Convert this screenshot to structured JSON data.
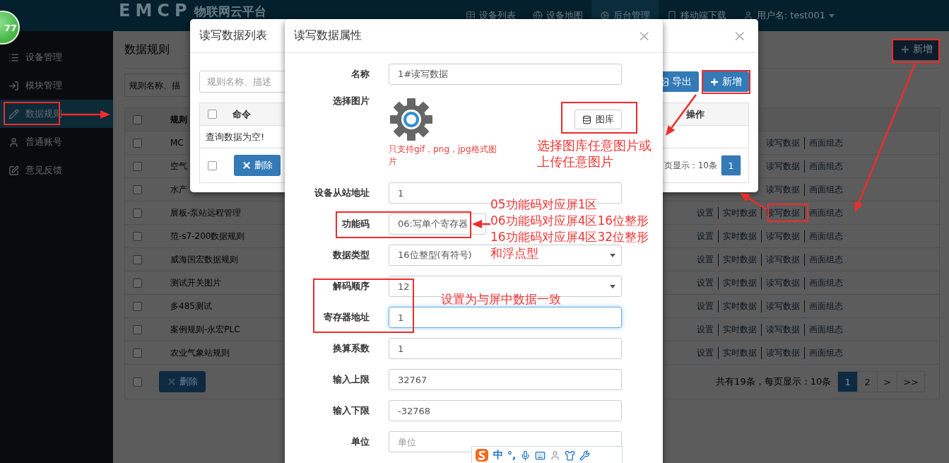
{
  "badge": {
    "text": "77"
  },
  "header": {
    "logo": "EMCP",
    "title": "物联网云平台",
    "nav": [
      {
        "label": "设备列表",
        "selected": false
      },
      {
        "label": "设备地图",
        "selected": false
      },
      {
        "label": "后台管理",
        "selected": true
      },
      {
        "label": "移动端下载",
        "selected": false
      },
      {
        "label": "用户名: test001",
        "selected": false
      }
    ]
  },
  "sidebar": {
    "items": [
      {
        "label": "设备管理",
        "selected": false
      },
      {
        "label": "模块管理",
        "selected": false
      },
      {
        "label": "数据规则",
        "selected": true
      },
      {
        "label": "普通账号",
        "selected": false
      },
      {
        "label": "意见反馈",
        "selected": false
      }
    ]
  },
  "page": {
    "title": "数据规则",
    "add_button": "新增",
    "search": {
      "placeholder": "规则名称、描"
    },
    "table": {
      "header": {
        "name": "规则",
        "checked": false
      },
      "rows": [
        {
          "name": "MC",
          "checked": false,
          "actions": [
            "读写数据",
            "画面组态"
          ]
        },
        {
          "name": "空气",
          "checked": false,
          "actions": [
            "读写数据",
            "画面组态"
          ]
        },
        {
          "name": "水产",
          "checked": false,
          "actions": [
            "读写数据",
            "画面组态"
          ]
        },
        {
          "name": "展板-泵站远程管理",
          "checked": false,
          "actions": [
            "设置",
            "实时数据",
            "读写数据",
            "画面组态"
          ]
        },
        {
          "name": "范-s7-200数据规则",
          "checked": false,
          "actions": [
            "设置",
            "实时数据",
            "读写数据",
            "画面组态"
          ]
        },
        {
          "name": "威海国宏数据规则",
          "checked": false,
          "actions": [
            "设置",
            "实时数据",
            "读写数据",
            "画面组态"
          ]
        },
        {
          "name": "测试开关图片",
          "checked": false,
          "actions": [
            "设置",
            "实时数据",
            "读写数据",
            "画面组态"
          ]
        },
        {
          "name": "多485测试",
          "checked": false,
          "actions": [
            "设置",
            "实时数据",
            "读写数据",
            "画面组态"
          ]
        },
        {
          "name": "案例规则-永宏PLC",
          "checked": false,
          "actions": [
            "设置",
            "实时数据",
            "读写数据",
            "画面组态"
          ]
        },
        {
          "name": "农业气象站规则",
          "checked": false,
          "actions": [
            "设置",
            "实时数据",
            "读写数据",
            "画面组态"
          ]
        }
      ]
    },
    "footer": {
      "checked": false,
      "delete_button": "删除",
      "summary": "共有19条，每页显示：10条",
      "pages": [
        {
          "label": "1",
          "selected": true
        },
        {
          "label": "2",
          "selected": false
        },
        {
          "label": ">",
          "selected": false
        },
        {
          "label": ">>",
          "selected": false
        }
      ]
    }
  },
  "list_dialog": {
    "title": "读写数据列表",
    "close": "×",
    "search": {
      "placeholder": "规则名称、描述"
    },
    "export_button": "导出",
    "add_button": "新增",
    "table": {
      "header_checked": false,
      "columns": [
        "命令",
        "操作"
      ],
      "empty_text": "查询数据为空!",
      "footer_checked": false,
      "delete_button": "删除",
      "summary": "页显示：10条",
      "pages": [
        {
          "label": "1",
          "selected": true
        }
      ]
    }
  },
  "property_dialog": {
    "title": "读写数据属性",
    "close": "×",
    "fields": [
      {
        "kind": "text",
        "label": "名称",
        "value": "1#读写数据",
        "focused": false
      },
      {
        "kind": "image",
        "label": "选择图片",
        "button": "图库",
        "note": "只支持gif，png，jpg格式图片"
      },
      {
        "kind": "text",
        "label": "设备从站地址",
        "value": "1",
        "focused": false
      },
      {
        "kind": "text",
        "label": "功能码",
        "value": "06:写单个寄存器",
        "focused": false
      },
      {
        "kind": "select",
        "label": "数据类型",
        "value": "16位整型(有符号)"
      },
      {
        "kind": "select",
        "label": "解码顺序",
        "value": "12"
      },
      {
        "kind": "text",
        "label": "寄存器地址",
        "value": "1",
        "focused": true
      },
      {
        "kind": "text",
        "label": "换算系数",
        "value": "1",
        "focused": false
      },
      {
        "kind": "text",
        "label": "输入上限",
        "value": "32767",
        "focused": false
      },
      {
        "kind": "text",
        "label": "输入下限",
        "value": "-32768",
        "focused": false
      },
      {
        "kind": "text",
        "label": "单位",
        "placeholder": "单位",
        "focused": false
      }
    ]
  },
  "annotations": {
    "notes": [
      {
        "lines": [
          "选择图库任意图片或",
          "上传任意图片"
        ]
      },
      {
        "lines": [
          "05功能码对应屏1区",
          "06功能码对应屏4区16位整形",
          "16功能码对应屏4区32位整形",
          "和浮点型"
        ]
      },
      {
        "lines": [
          "设置为与屏中数据一致"
        ]
      }
    ]
  },
  "ime_toolbar": {
    "items": [
      "中",
      "°,"
    ]
  }
}
